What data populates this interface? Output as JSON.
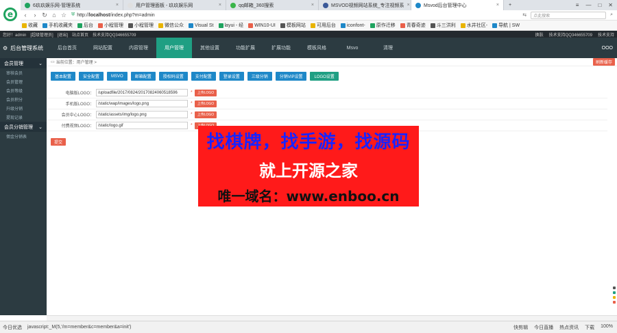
{
  "browser": {
    "tabs": [
      {
        "label": "6玖玖娱乐网-管理系统",
        "icon_color": "#1fa35f",
        "active": false
      },
      {
        "label": "用户管理面板 - 玖玖娱乐网",
        "icon_color": "#e0e0e0",
        "active": false
      },
      {
        "label": "qq邮箱_360搜索",
        "icon_color": "#3bb54a",
        "active": false
      },
      {
        "label": "MSVOD视频网站系统_专注视频系",
        "icon_color": "#3b5998",
        "active": false
      },
      {
        "label": "Msvod后台管理中心",
        "icon_color": "#1e88c8",
        "active": true
      }
    ],
    "new_tab": "+",
    "window_controls": [
      "≡",
      "—",
      "□",
      "✕"
    ],
    "url_scheme": "http://",
    "url_host": "localhost",
    "url_path": "/index.php?m=admin",
    "search_placeholder": "点此搜索",
    "bookmarks": [
      "收藏",
      "手机收藏夹",
      "后台",
      "小程管理",
      "小程管理",
      "微信公众",
      "Visual St",
      "layui - 经",
      "WIN10-UI",
      "模板网站",
      "可用后台",
      "iconfont-",
      "原作迁移",
      "青春奇迹",
      "斗三洪利",
      "水井社区-",
      "导航 | SW"
    ]
  },
  "topline": {
    "left": [
      "您好！admin",
      "[超级管理员]",
      "[退出]",
      "站点首页",
      "技术支持QQ346655709"
    ],
    "right": [
      "换肤",
      "技术支持QQ346655709",
      "技术支持"
    ]
  },
  "header": {
    "brand": "后台管理系统",
    "menu": [
      "后台首页",
      "网站配置",
      "内容管理",
      "用户管理",
      "其他设置",
      "功能扩展",
      "扩展功能",
      "模板风格",
      "Msvo",
      "清理"
    ],
    "active_index": 3,
    "right_label": "OOO"
  },
  "sidebar": {
    "groups": [
      {
        "title": "会员管理",
        "items": [
          "审核会员",
          "会员管理",
          "会员等级",
          "会员积分",
          "升级分销",
          "提现记录"
        ]
      },
      {
        "title": "会员分销管理",
        "items": [
          "佣金分销表"
        ]
      }
    ]
  },
  "main": {
    "breadcrumb": "当前位置：用户管理 >",
    "refresh_label": "刷新缓存",
    "buttons": [
      "基本配置",
      "安全配置",
      "MSVO",
      "邮箱配置",
      "授权码设置",
      "支付配置",
      "登录设置",
      "三级分销",
      "分销VIP设置",
      "LOGO设置"
    ],
    "fields": [
      {
        "label": "电脑版LOGO：",
        "value": "/uploadfile/2017/0824/20170824060518596",
        "upload": "上传LOGO"
      },
      {
        "label": "手机版LOGO：",
        "value": "/static/wap/images/logo.png",
        "upload": "上传LOGO"
      },
      {
        "label": "会员中心LOGO：",
        "value": "/static/assets/img/logo.png",
        "upload": "上传LOGO"
      },
      {
        "label": "付费视频LOGO：",
        "value": "/static/logo.gif",
        "upload": "上传LOGO"
      }
    ],
    "required_mark": "*",
    "submit_label": "提交"
  },
  "ad": {
    "line1": "找棋牌，找手游，找源码",
    "line2": "就上开源之家",
    "line3": "唯一域名：www.enboo.cn"
  },
  "statusbar": {
    "left": "今日优选",
    "url": "javascript:_M(5,'/m=member&c=member&a=init')",
    "right": [
      "快剪辑",
      "今日直播",
      "热点资讯",
      "下载",
      "100%"
    ]
  }
}
